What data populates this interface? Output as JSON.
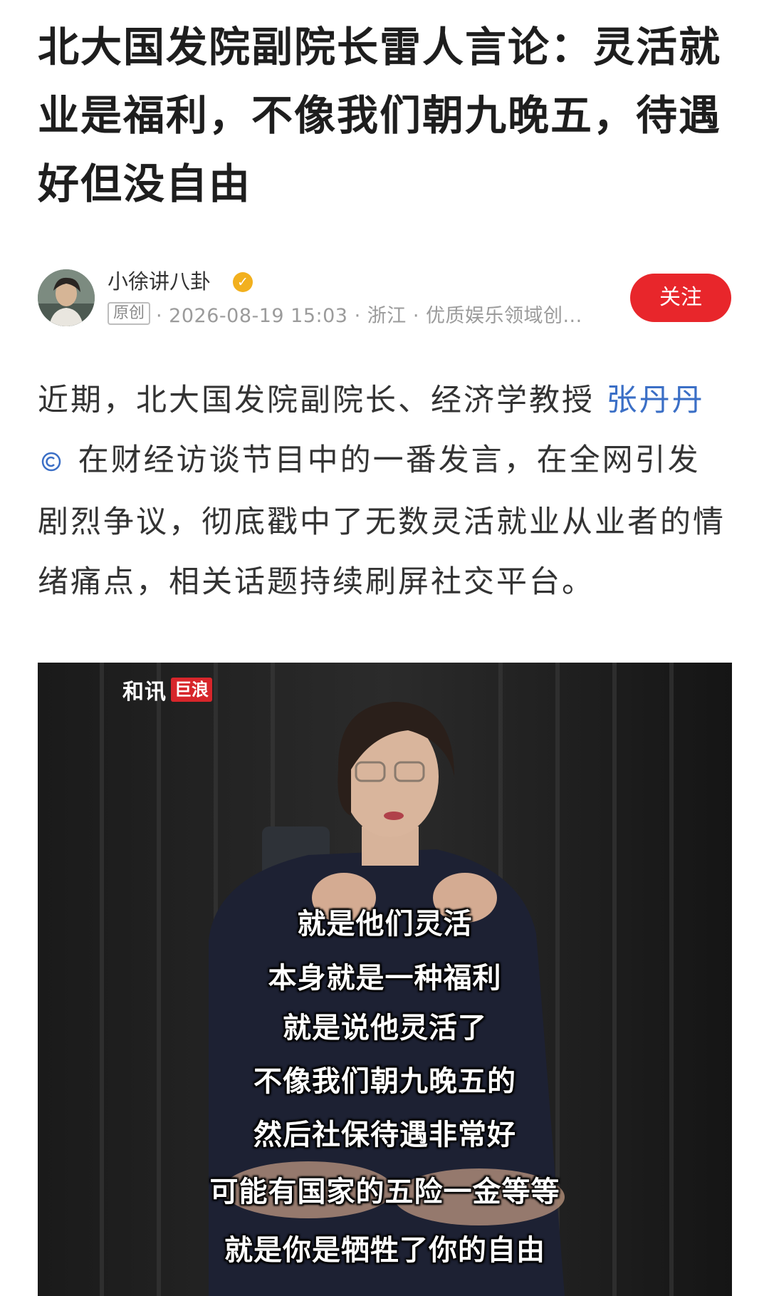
{
  "article": {
    "title": "北大国发院副院长雷人言论：灵活就业是福利，不像我们朝九晚五，待遇好但没自由"
  },
  "author": {
    "name": "小徐讲八卦",
    "verified_icon": "verified-badge-icon",
    "original_tag": "原创",
    "meta": "· 2026-08-19 15:03 · 浙江 · 优质娱乐领域创...",
    "follow_label": "关注"
  },
  "content": {
    "para_before": "近期，北大国发院副院长、经济学教授 ",
    "mention": "张丹丹",
    "para_after": " 在财经访谈节目中的一番发言，在全网引发剧烈争议，彻底戳中了无数灵活就业从业者的情绪痛点，相关话题持续刷屏社交平台。"
  },
  "video": {
    "brand": "和讯",
    "brand_tag": "巨浪",
    "captions": [
      "就是他们灵活",
      "本身就是一种福利",
      "就是说他灵活了",
      "不像我们朝九晚五的",
      "然后社保待遇非常好",
      "可能有国家的五险一金等等",
      "就是你是牺牲了你的自由"
    ]
  },
  "colors": {
    "accent": "#e8262b",
    "link": "#3b6fc6",
    "verified": "#f2b01e"
  }
}
